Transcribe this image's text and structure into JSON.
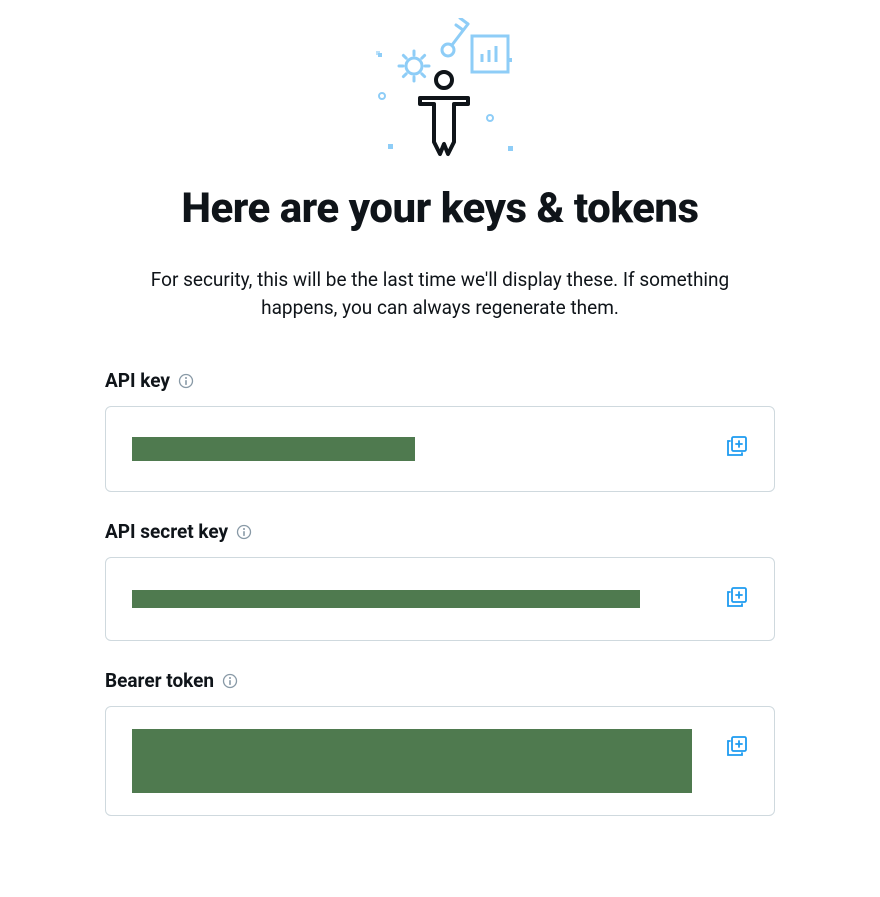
{
  "page": {
    "title": "Here are your keys & tokens",
    "subtitle": "For security, this will be the last time we'll display these. If something happens, you can always regenerate them."
  },
  "fields": {
    "api_key": {
      "label": "API key",
      "value_redacted": true
    },
    "api_secret_key": {
      "label": "API secret key",
      "value_redacted": true
    },
    "bearer_token": {
      "label": "Bearer token",
      "value_redacted": true
    }
  },
  "icons": {
    "info": "info-icon",
    "copy": "copy-plus-icon"
  },
  "colors": {
    "accent": "#1d9bf0",
    "border": "#cfd9de",
    "redaction": "#4f7a4f",
    "text": "#0f1419",
    "illustration_blue": "#8ecdf7"
  }
}
